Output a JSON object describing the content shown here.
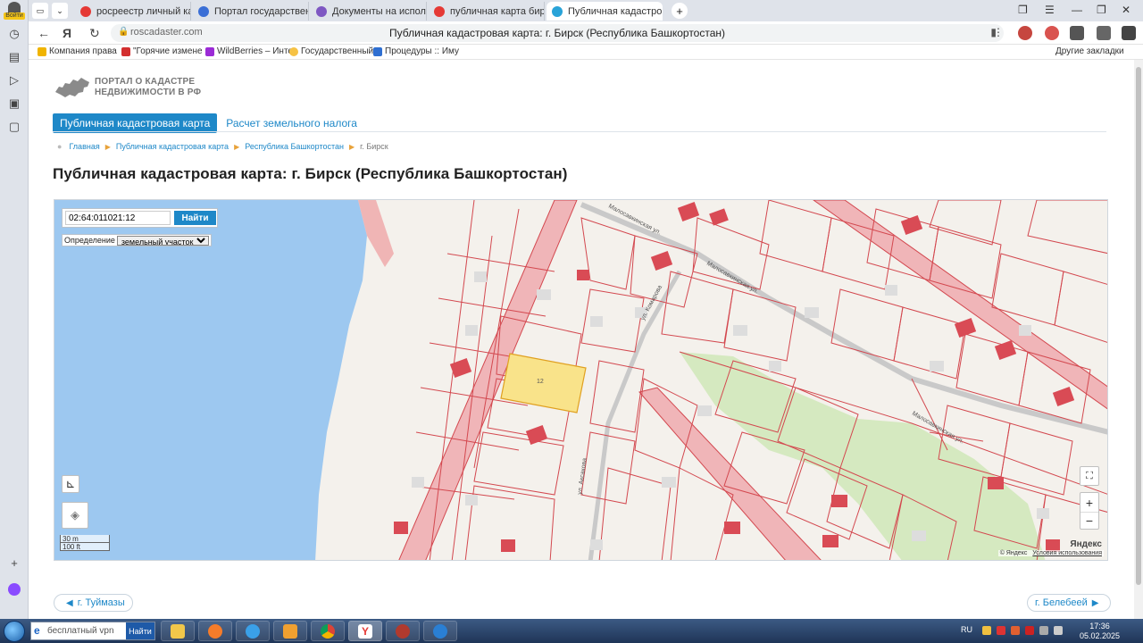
{
  "browser": {
    "profile_label": "Войти",
    "tabs": [
      {
        "label": "росреестр личный кабин",
        "color": "#e53935"
      },
      {
        "label": "Портал государственных",
        "color": "#3b6fd6"
      },
      {
        "label": "Документы на исполнени",
        "color": "#7e57c2"
      },
      {
        "label": "публичная карта бирска",
        "color": "#e53935"
      },
      {
        "label": "Публичная кадастрова",
        "color": "#29a3d8"
      }
    ],
    "url": "roscadaster.com",
    "page_title": "Публичная кадастровая карта: г. Бирск (Республика Башкортостан)",
    "bookmarks": [
      {
        "label": "Компания права",
        "color": "#f0b400"
      },
      {
        "label": "\"Горячие измене",
        "color": "#d32f2f"
      },
      {
        "label": "WildBerries – Инте",
        "color": "#9b2bd6"
      },
      {
        "label": "Государственный",
        "color": "#f6c244"
      },
      {
        "label": "Процедуры :: Иму",
        "color": "#2f6fd1"
      }
    ],
    "other_bookmarks": "Другие закладки"
  },
  "site": {
    "logo_line1": "ПОРТАЛ О КАДАСТРЕ",
    "logo_line2": "НЕДВИЖИМОСТИ В РФ",
    "menu_active": "Публичная кадастровая карта",
    "menu_link": "Расчет земельного налога",
    "breadcrumbs": [
      "Главная",
      "Публичная кадастровая карта",
      "Республика Башкортостан",
      "г. Бирск"
    ],
    "heading": "Публичная кадастровая карта: г. Бирск (Республика Башкортостан)",
    "prev_city": "г. Туймазы",
    "next_city": "г. Белебеей"
  },
  "map": {
    "search_value": "02:64:011021:12",
    "search_button": "Найти",
    "definition_label": "Определение",
    "definition_value": "земельный участок",
    "scale_m": "30 m",
    "scale_ft": "100 ft",
    "copyright": "© Яндекс",
    "terms": "Условия использования",
    "yandex": "Яндекс",
    "zoom_in": "+",
    "zoom_out": "−",
    "streets": [
      {
        "name": "Малосавкинская ул."
      },
      {
        "name": "ул. Комарова"
      },
      {
        "name": "ул. Аксакова"
      }
    ],
    "highlighted_parcel": {
      "number": "12",
      "color": "#f9e38a"
    }
  },
  "taskbar": {
    "search_placeholder": "бесплатный vpn",
    "search_button": "Найти",
    "lang": "RU",
    "time": "17:36",
    "date": "05.02.2025"
  }
}
